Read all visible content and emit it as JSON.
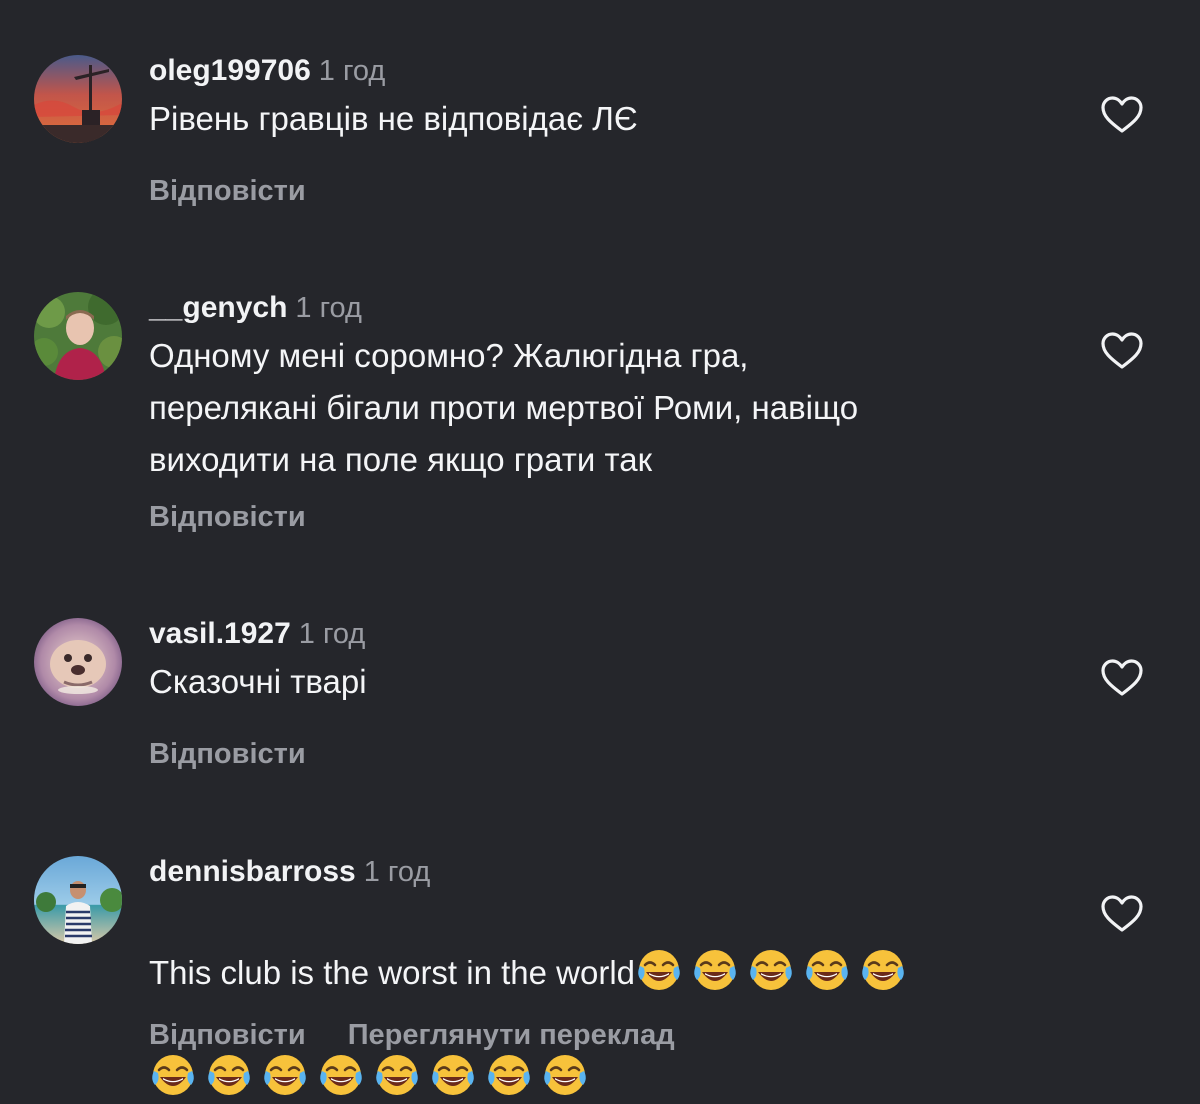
{
  "comments": [
    {
      "username": "oleg199706",
      "time": "1 год",
      "text": "Рівень гравців не відповідає ЛЄ",
      "reply_label": "Відповісти",
      "avatar_icon": "sunset-crane-photo"
    },
    {
      "username": "__genych",
      "time": "1 год",
      "text": "Одному мені соромно? Жалюгідна гра,\nперелякані бігали проти мертвої Роми, навіщо\nвиходити на поле якщо грати так",
      "reply_label": "Відповісти",
      "avatar_icon": "person-greenery-photo"
    },
    {
      "username": "vasil.1927",
      "time": "1 год",
      "text": "Сказочні тварі",
      "reply_label": "Відповісти",
      "avatar_icon": "dog-face-photo"
    },
    {
      "username": "dennisbarross",
      "time": "1 год",
      "text": "This club is the worst in the world",
      "emoji_line1_count": 5,
      "emoji_line2_count": 8,
      "emoji_name": "face-with-tears-of-joy",
      "reply_label": "Відповісти",
      "translate_label": "Переглянути переклад",
      "avatar_icon": "person-beach-photo"
    }
  ],
  "colors": {
    "background": "#25262b",
    "primary_text": "#f2f3f5",
    "secondary_text": "#9a9ca3"
  }
}
